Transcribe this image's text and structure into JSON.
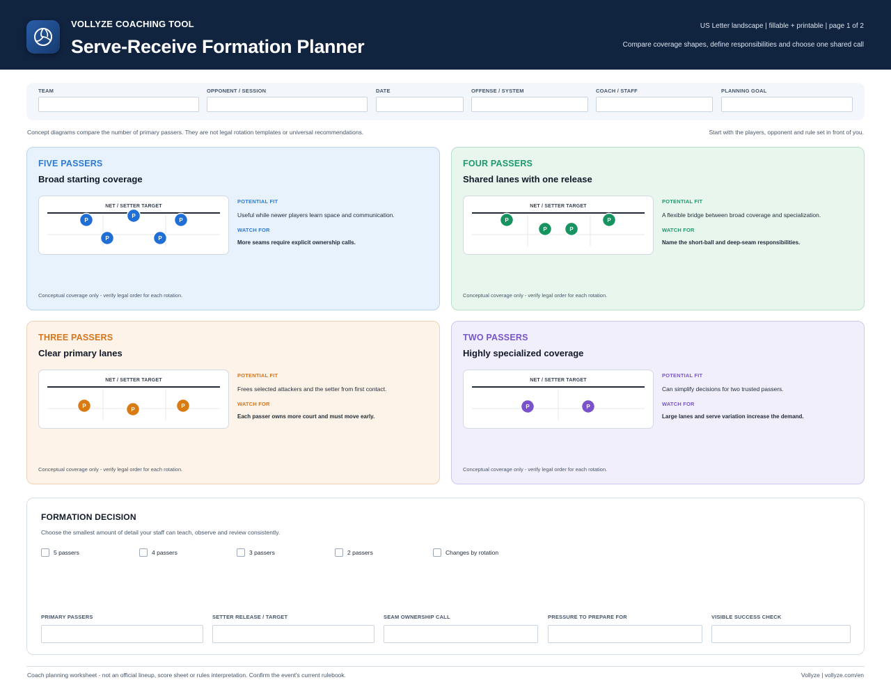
{
  "header": {
    "brand": "VOLLYZE COACHING TOOL",
    "title": "Serve-Receive Formation Planner",
    "meta": "US Letter landscape | fillable + printable | page 1 of 2",
    "subtitle": "Compare coverage shapes, define responsibilities and choose one shared call",
    "logo_icon": "volleyball-icon"
  },
  "fields": [
    {
      "label": "TEAM",
      "value": ""
    },
    {
      "label": "OPPONENT / SESSION",
      "value": ""
    },
    {
      "label": "DATE",
      "value": ""
    },
    {
      "label": "OFFENSE / SYSTEM",
      "value": ""
    },
    {
      "label": "COACH / STAFF",
      "value": ""
    },
    {
      "label": "PLANNING GOAL",
      "value": ""
    }
  ],
  "notes": {
    "left": "Concept diagrams compare the number of primary passers. They are not legal rotation templates or universal recommendations.",
    "right": "Start with the players, opponent and rule set in front of you."
  },
  "cards": [
    {
      "kicker": "FIVE PASSERS",
      "title": "Broad starting coverage",
      "net_label": "NET / SETTER TARGET",
      "passer_marker": "P",
      "passer_count": 5,
      "fit_label": "POTENTIAL FIT",
      "fit_text": "Useful while newer players learn space and communication.",
      "watch_label": "WATCH FOR",
      "watch_text": "More seams require explicit ownership calls.",
      "footnote": "Conceptual coverage only - verify legal order for each rotation.",
      "accent": "#2e7ad1",
      "bg": "#e8f2fd",
      "border": "#b9d3f0",
      "dot": "#1f6fd6"
    },
    {
      "kicker": "FOUR PASSERS",
      "title": "Shared lanes with one release",
      "net_label": "NET / SETTER TARGET",
      "passer_marker": "P",
      "passer_count": 4,
      "fit_label": "POTENTIAL FIT",
      "fit_text": "A flexible bridge between broad coverage and specialization.",
      "watch_label": "WATCH FOR",
      "watch_text": "Name the short-ball and deep-seam responsibilities.",
      "footnote": "Conceptual coverage only - verify legal order for each rotation.",
      "accent": "#1e9a68",
      "bg": "#e8f6ee",
      "border": "#b8e0c9",
      "dot": "#16935f"
    },
    {
      "kicker": "THREE PASSERS",
      "title": "Clear primary lanes",
      "net_label": "NET / SETTER TARGET",
      "passer_marker": "P",
      "passer_count": 3,
      "fit_label": "POTENTIAL FIT",
      "fit_text": "Frees selected attackers and the setter from first contact.",
      "watch_label": "WATCH FOR",
      "watch_text": "Each passer owns more court and must move early.",
      "footnote": "Conceptual coverage only - verify legal order for each rotation.",
      "accent": "#d7751c",
      "bg": "#fdf3e8",
      "border": "#f0d2b3",
      "dot": "#d97a12"
    },
    {
      "kicker": "TWO PASSERS",
      "title": "Highly specialized coverage",
      "net_label": "NET / SETTER TARGET",
      "passer_marker": "P",
      "passer_count": 2,
      "fit_label": "POTENTIAL FIT",
      "fit_text": "Can simplify decisions for two trusted passers.",
      "watch_label": "WATCH FOR",
      "watch_text": "Large lanes and serve variation increase the demand.",
      "footnote": "Conceptual coverage only - verify legal order for each rotation.",
      "accent": "#7856c9",
      "bg": "#f1effc",
      "border": "#cfc6ee",
      "dot": "#7a52cc"
    }
  ],
  "decision": {
    "title": "FORMATION DECISION",
    "subtitle": "Choose the smallest amount of detail your staff can teach, observe and review consistently.",
    "options": [
      {
        "label": "5 passers",
        "checked": false
      },
      {
        "label": "4 passers",
        "checked": false
      },
      {
        "label": "3 passers",
        "checked": false
      },
      {
        "label": "2 passers",
        "checked": false
      },
      {
        "label": "Changes by rotation",
        "checked": false
      }
    ],
    "fields": [
      {
        "label": "PRIMARY PASSERS",
        "value": ""
      },
      {
        "label": "SETTER RELEASE / TARGET",
        "value": ""
      },
      {
        "label": "SEAM OWNERSHIP CALL",
        "value": ""
      },
      {
        "label": "PRESSURE TO PREPARE FOR",
        "value": ""
      },
      {
        "label": "VISIBLE SUCCESS CHECK",
        "value": ""
      }
    ]
  },
  "footer": {
    "left": "Coach planning worksheet - not an official lineup, score sheet or rules interpretation. Confirm the event's current rulebook.",
    "right": "Vollyze | vollyze.com/en"
  }
}
